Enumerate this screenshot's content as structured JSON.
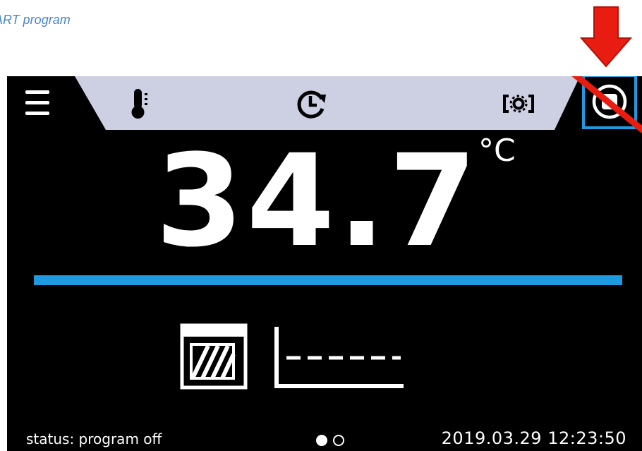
{
  "caption": {
    "text": "ART program"
  },
  "colors": {
    "accent": "#1e9be0",
    "annotation": "#e81c10",
    "tab_bg": "#cdcfe2",
    "caption": "#4a86c8"
  },
  "topbar": {
    "menu_icon": "hamburger-icon",
    "tabs": [
      {
        "icon": "thermometer-icon"
      },
      {
        "icon": "clock-refresh-icon"
      },
      {
        "icon": "camera-settings-icon"
      }
    ],
    "stop_icon": "stop-icon"
  },
  "main": {
    "temperature": "34.7",
    "unit": "°C"
  },
  "indicators": {
    "door_icon": "door-icon",
    "program_graph_icon": "program-graph-icon"
  },
  "footer": {
    "status": "status: program off",
    "page_count": 2,
    "active_page": 1,
    "datetime": "2019.03.29  12:23:50"
  }
}
